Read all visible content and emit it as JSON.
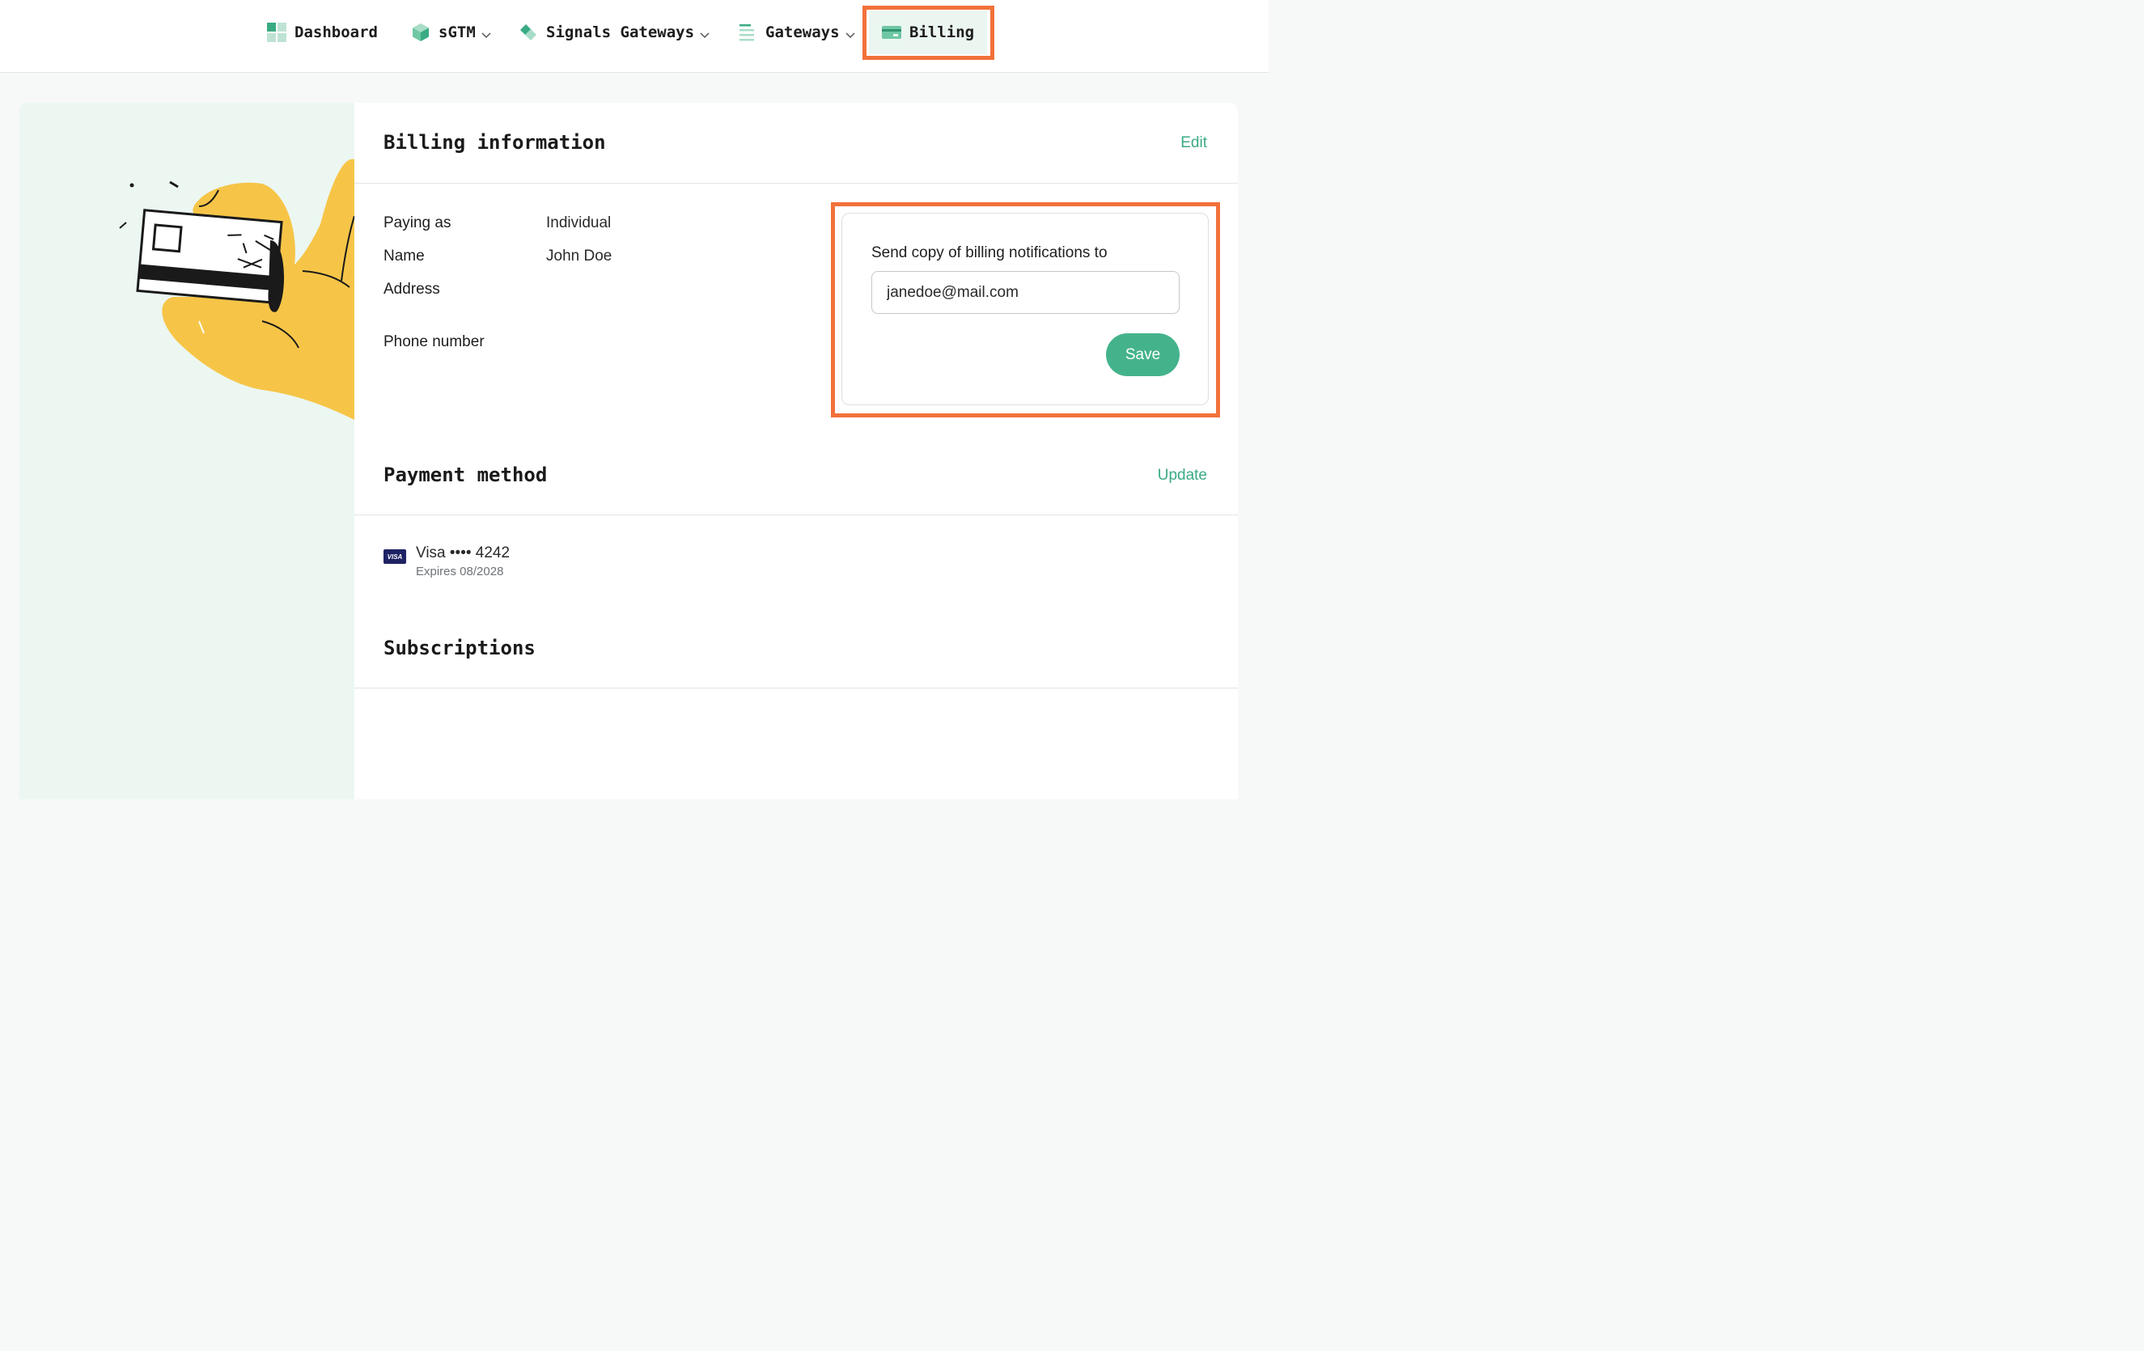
{
  "nav": {
    "items": [
      {
        "label": "Dashboard",
        "icon": "dashboard-grid-icon"
      },
      {
        "label": "sGTM",
        "icon": "cube-icon",
        "dropdown": true
      },
      {
        "label": "Signals Gateways",
        "icon": "diamond-signal-icon",
        "dropdown": true
      },
      {
        "label": "Gateways",
        "icon": "list-lines-icon",
        "dropdown": true
      },
      {
        "label": "Billing",
        "icon": "credit-card-icon",
        "active": true
      }
    ]
  },
  "billing_info": {
    "title": "Billing information",
    "edit_label": "Edit",
    "fields": [
      {
        "label": "Paying as",
        "value": "Individual"
      },
      {
        "label": "Name",
        "value": "John Doe"
      },
      {
        "label": "Address",
        "value": ""
      },
      {
        "label": "Phone number",
        "value": ""
      }
    ],
    "notifications": {
      "label": "Send copy of billing notifications to",
      "email_value": "janedoe@mail.com",
      "save_label": "Save"
    }
  },
  "payment": {
    "title": "Payment method",
    "update_label": "Update",
    "card_brand_badge": "VISA",
    "card_text": "Visa •••• 4242",
    "expires": "Expires 08/2028"
  },
  "subscriptions": {
    "title": "Subscriptions"
  },
  "colors": {
    "accent_green": "#44b38b",
    "link_green": "#3aab83",
    "highlight_orange": "#f2713a",
    "illustration_bg": "#ecf7f2",
    "hand_yellow": "#f6c548"
  }
}
